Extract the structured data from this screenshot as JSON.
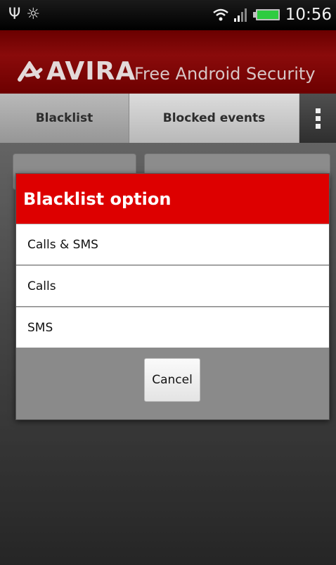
{
  "status_bar": {
    "time": "10:56",
    "icons": [
      "usb-icon",
      "android-debug-icon",
      "wifi-icon",
      "signal-icon",
      "battery-icon"
    ],
    "battery_color": "#2ecc40"
  },
  "header": {
    "brand": "AVIRA",
    "subtitle": "Free Android Security",
    "accent_color": "#8a0b0b"
  },
  "tabs": [
    {
      "label": "Blacklist"
    },
    {
      "label": "Blocked events"
    }
  ],
  "dialog": {
    "title": "Blacklist option",
    "title_color": "#dd0000",
    "options": [
      {
        "label": "Calls & SMS"
      },
      {
        "label": "Calls"
      },
      {
        "label": "SMS"
      }
    ],
    "cancel_label": "Cancel"
  }
}
